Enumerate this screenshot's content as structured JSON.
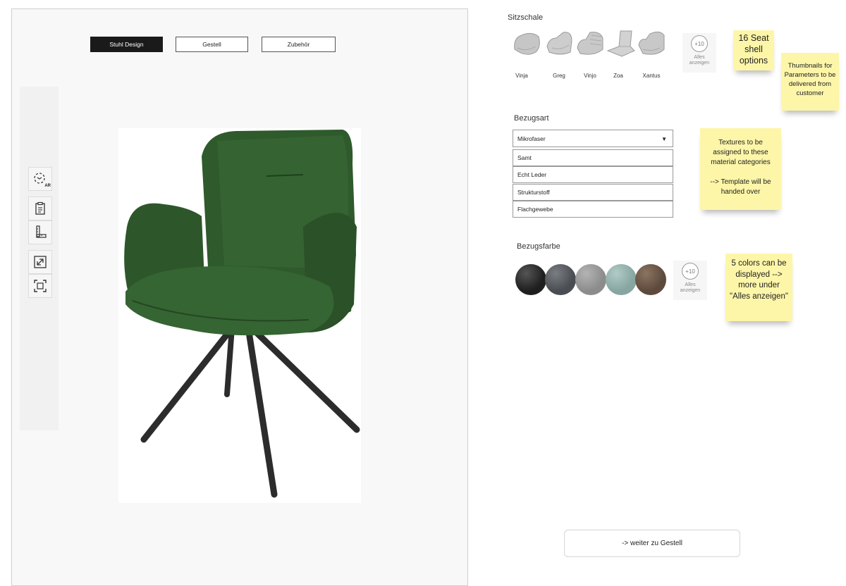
{
  "tabs": [
    {
      "label": "Stuhl Design"
    },
    {
      "label": "Gestell"
    },
    {
      "label": "Zubehör"
    }
  ],
  "toolbar_icons": [
    "ar-view-icon",
    "clipboard-icon",
    "measure-icon",
    "expand-icon",
    "fit-frame-icon"
  ],
  "ar_label": "AR",
  "seat_shell": {
    "title": "Sitzschale",
    "options": [
      {
        "label": "Vinja"
      },
      {
        "label": "Greg"
      },
      {
        "label": "Vinjo"
      },
      {
        "label": "Zoa"
      },
      {
        "label": "Xantus"
      }
    ],
    "more_count": "+10",
    "more_label_1": "Alles",
    "more_label_2": "anzeigen"
  },
  "cover_type": {
    "title": "Bezugsart",
    "selected": "Mikrofaser",
    "options": [
      {
        "label": "Samt"
      },
      {
        "label": "Echt Leder"
      },
      {
        "label": "Strukturstoff"
      },
      {
        "label": "Flachgewebe"
      }
    ]
  },
  "cover_color": {
    "title": "Bezugsfarbe",
    "swatches": [
      {
        "color": "#1e1e1e"
      },
      {
        "color": "#4a4d52"
      },
      {
        "color": "#8c8c8c"
      },
      {
        "color": "#87a5a1"
      },
      {
        "color": "#5e4a3c"
      }
    ],
    "more_count": "+10",
    "more_label_1": "Alles",
    "more_label_2": "anzeigen"
  },
  "notes": {
    "seat_options": "16 Seat shell options",
    "thumbnails": "Thumbnails for Parameters to be delivered from customer",
    "textures_1": "Textures to be assigned to these material categories",
    "textures_2": "--> Template will be handed over",
    "colors": "5 colors can be displayed --> more under \"Alles anzeigen\""
  },
  "next_button": "-> weiter zu Gestell",
  "chair_color": "#2f5a2c"
}
